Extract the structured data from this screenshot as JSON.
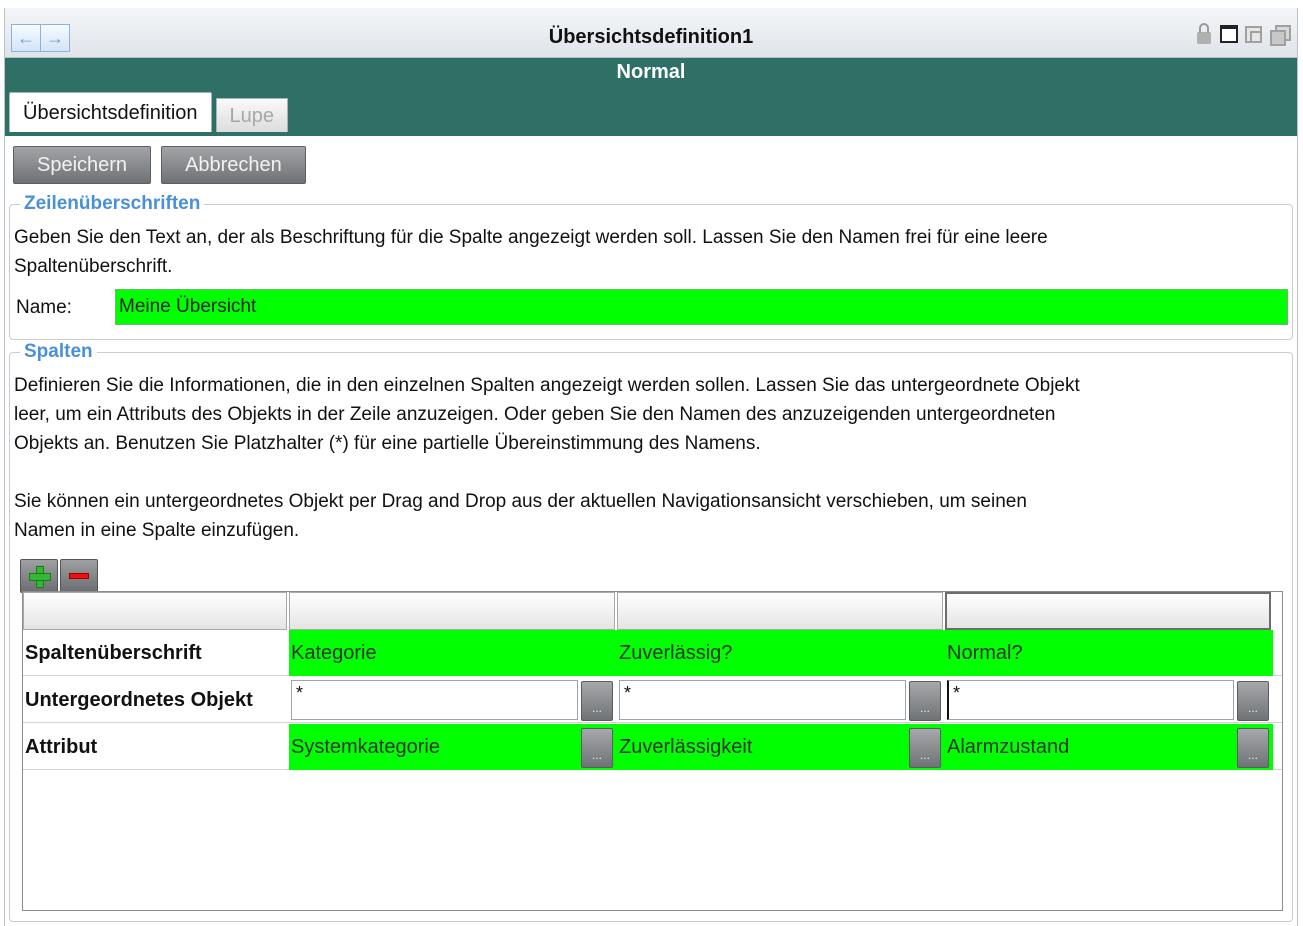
{
  "window": {
    "title": "Übersichtsdefinition1",
    "nav_back": "←",
    "nav_forward": "→",
    "status": "Normal"
  },
  "tabs": [
    {
      "label": "Übersichtsdefinition",
      "active": true
    },
    {
      "label": "Lupe",
      "active": false
    }
  ],
  "toolbar": {
    "save_label": "Speichern",
    "cancel_label": "Abbrechen"
  },
  "row_headers_section": {
    "legend": "Zeilenüberschriften",
    "description": "Geben Sie den Text an, der als Beschriftung für die Spalte angezeigt werden soll.  Lassen Sie den Namen frei für eine leere\nSpaltenüberschrift.",
    "name_label": "Name:",
    "name_value": "Meine Übersicht"
  },
  "columns_section": {
    "legend": "Spalten",
    "description": "Definieren Sie die Informationen, die in den einzelnen Spalten angezeigt werden sollen.  Lassen Sie das untergeordnete Objekt\nleer, um ein Attributs des Objekts in der Zeile anzuzeigen.  Oder geben Sie den Namen des anzuzeigenden untergeordneten\nObjekts an. Benutzen Sie Platzhalter (*) für eine partielle Übereinstimmung des Namens.\n\nSie können ein untergeordnetes Objekt per Drag and Drop aus der aktuellen Navigationsansicht verschieben, um seinen\nNamen in eine Spalte einzufügen."
  },
  "grid": {
    "row_labels": {
      "header": "Spaltenüberschrift",
      "child": "Untergeordnetes Objekt",
      "attribute": "Attribut"
    },
    "columns": [
      {
        "header": "Kategorie",
        "child": "*",
        "attribute": "Systemkategorie"
      },
      {
        "header": "Zuverlässig?",
        "child": "*",
        "attribute": "Zuverlässigkeit"
      },
      {
        "header": "Normal?",
        "child": "*",
        "attribute": "Alarmzustand"
      }
    ],
    "browse_label": "..."
  },
  "colors": {
    "status_bar": "#2e6f66",
    "highlight_green": "#00ff00",
    "legend_blue": "#4a90d9"
  }
}
